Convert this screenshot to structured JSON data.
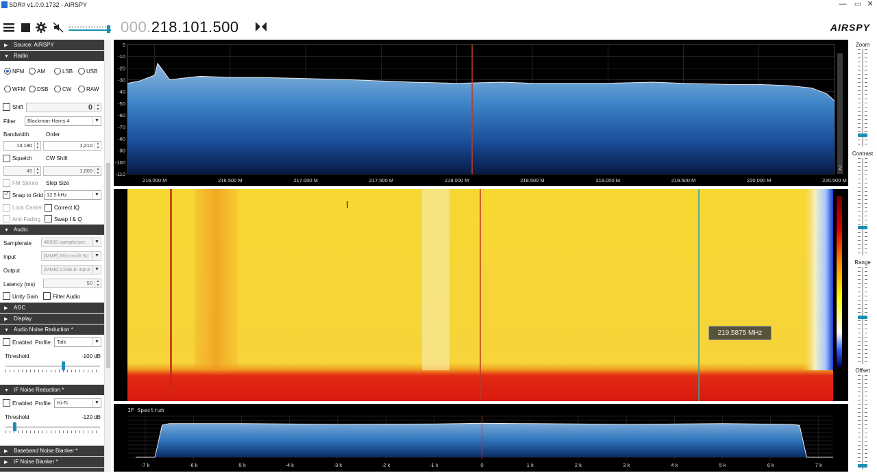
{
  "window": {
    "title": "SDR# v1.0.0.1732 - AIRSPY",
    "controls": [
      "—",
      "▭",
      "✕"
    ]
  },
  "toolbar": {
    "frequency_prefix": "000.",
    "frequency_main": "218.101.500",
    "brand": "AIRSPY",
    "volume_level": 0.95
  },
  "sidebar": {
    "source": {
      "title": "Source: AIRSPY"
    },
    "radio": {
      "title": "Radio",
      "modes": [
        {
          "label": "NFM",
          "checked": true
        },
        {
          "label": "AM",
          "checked": false
        },
        {
          "label": "LSB",
          "checked": false
        },
        {
          "label": "USB",
          "checked": false
        },
        {
          "label": "WFM",
          "checked": false
        },
        {
          "label": "DSB",
          "checked": false
        },
        {
          "label": "CW",
          "checked": false
        },
        {
          "label": "RAW",
          "checked": false
        }
      ],
      "shift_label": "Shift",
      "shift_value": "0",
      "filter_label": "Filter",
      "filter_value": "Blackman-Harris 4",
      "bandwidth_label": "Bandwidth",
      "bandwidth_value": "13,180",
      "order_label": "Order",
      "order_value": "1,210",
      "squelch_label": "Squelch",
      "squelch_value": "45",
      "cwshift_label": "CW Shift",
      "cwshift_value": "1,000",
      "fmstereo_label": "FM Stereo",
      "stepsize_label": "Step Size",
      "snap_label": "Snap to Grid",
      "snap_value": "12.5 kHz",
      "lockcarrier_label": "Lock Carrier",
      "correctiq_label": "Correct IQ",
      "antifading_label": "Anti-Fading",
      "swapiq_label": "Swap I & Q"
    },
    "audio": {
      "title": "Audio",
      "samplerate_label": "Samplerate",
      "samplerate_value": "48000 sample/sec",
      "input_label": "Input",
      "input_value": "[MME] Microsoft So",
      "output_label": "Output",
      "output_value": "[MME] CABLE Input",
      "latency_label": "Latency (ms)",
      "latency_value": "50",
      "unity_label": "Unity Gain",
      "filteraudio_label": "Filter Audio"
    },
    "agc": {
      "title": "AGC"
    },
    "display": {
      "title": "Display"
    },
    "anr": {
      "title": "Audio Noise Reduction *",
      "enabled_label": "Enabled",
      "profile_label": "Profile:",
      "profile_value": "Talk",
      "threshold_label": "Threshold",
      "threshold_value": "-100 dB",
      "threshold_level": 0.62
    },
    "ifnr": {
      "title": "IF Noise Reduction *",
      "enabled_label": "Enabled",
      "profile_label": "Profile:",
      "profile_value": "Hi-Fi",
      "threshold_label": "Threshold",
      "threshold_value": "-120 dB",
      "threshold_level": 0.08
    },
    "bnb": {
      "title": "Baseband Noise Blanker *"
    },
    "ifnb": {
      "title": "IF Noise Blanker *"
    }
  },
  "right_panel": {
    "zoom_label": "Zoom",
    "contrast_label": "Contrast",
    "range_label": "Range",
    "offset_label": "Offset",
    "zoom_level": 0.1,
    "contrast_level": 0.28,
    "range_level": 0.48,
    "offset_level": 0.02
  },
  "tooltip": "219.5875 MHz",
  "chart_data": [
    {
      "type": "area",
      "name_ref": "rf-spectrum",
      "x_ticks": [
        "216.000 M",
        "216.500 M",
        "217.000 M",
        "217.500 M",
        "218.000 M",
        "218.500 M",
        "219.000 M",
        "219.500 M",
        "220.000 M",
        "220.500 M"
      ],
      "y_ticks": [
        "0",
        "-10",
        "-20",
        "-30",
        "-40",
        "-50",
        "-60",
        "-70",
        "-80",
        "-90",
        "-100",
        "-110"
      ],
      "ylim": [
        -110,
        0
      ],
      "xlim": [
        215.82,
        220.5
      ],
      "x": [
        215.82,
        215.9,
        216.0,
        216.02,
        216.1,
        216.3,
        216.5,
        216.7,
        217.0,
        217.3,
        217.5,
        217.7,
        218.0,
        218.3,
        218.5,
        218.8,
        219.0,
        219.3,
        219.5,
        219.8,
        220.0,
        220.2,
        220.35,
        220.45,
        220.5
      ],
      "y": [
        -33,
        -31,
        -26,
        -16,
        -30,
        -27,
        -28,
        -28,
        -29,
        -30,
        -31,
        -32,
        -33,
        -32,
        -33,
        -33,
        -33,
        -32,
        -33,
        -34,
        -34,
        -35,
        -37,
        -42,
        -48
      ],
      "cursor_x": 218.1015,
      "badge": "2"
    },
    {
      "type": "area",
      "name_ref": "if-spectrum",
      "title": "IF Spectrum",
      "x_ticks": [
        "-7 k",
        "-6 k",
        "-5 k",
        "-4 k",
        "-3 k",
        "-2 k",
        "-1 k",
        "0",
        "1 k",
        "2 k",
        "3 k",
        "4 k",
        "5 k",
        "6 k",
        "7 k"
      ],
      "xlim": [
        -7.2,
        7.3
      ],
      "x": [
        -7.2,
        -6.8,
        -6.65,
        -6.5,
        -5,
        -3,
        -1,
        0,
        1,
        3,
        5,
        6.4,
        6.6,
        6.75,
        7.3
      ],
      "y": [
        0,
        0,
        0.78,
        0.82,
        0.82,
        0.8,
        0.81,
        0.83,
        0.82,
        0.8,
        0.82,
        0.8,
        0.78,
        0,
        0
      ]
    }
  ]
}
